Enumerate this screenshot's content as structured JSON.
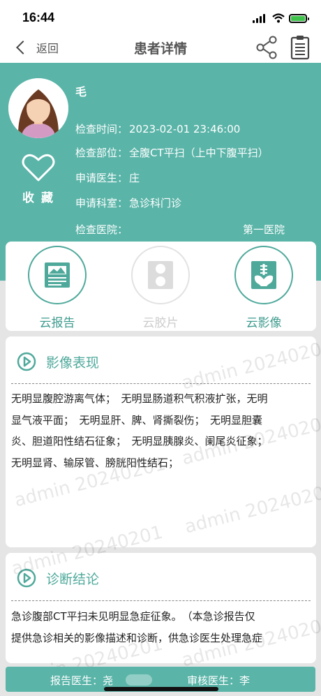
{
  "status_bar": {
    "time": "16:44"
  },
  "nav": {
    "back_label": "返回",
    "title": "患者详情",
    "share_icon": "share-icon",
    "report_icon": "clipboard-icon"
  },
  "patient": {
    "name": "毛",
    "favorite_label": "收 藏",
    "exam_time_label": "检查时间：",
    "exam_time": "2023-02-01 23:46:00",
    "exam_part_label": "检查部位：",
    "exam_part": "全腹CT平扫（上中下腹平扫）",
    "doctor_label": "申请医生：",
    "doctor": "庄",
    "dept_label": "申请科室：",
    "dept": "急诊科门诊",
    "hospital_label": "检查医院：",
    "hospital": "第一医院"
  },
  "tools": [
    {
      "label": "云报告",
      "icon": "report-icon",
      "enabled": true
    },
    {
      "label": "云胶片",
      "icon": "film-icon",
      "enabled": false
    },
    {
      "label": "云影像",
      "icon": "xray-icon",
      "enabled": true
    }
  ],
  "findings": {
    "title": "影像表现",
    "lines": [
      "无明显腹腔游离气体；　无明显肠道积气积液扩张，无明",
      "显气液平面；　无明显肝、脾、肾撕裂伤；　无明显胆囊",
      "炎、胆道阳性结石征象；　无明显胰腺炎、阑尾炎征象；",
      "无明显肾、输尿管、膀胱阳性结石；"
    ]
  },
  "conclusion": {
    "title": "诊断结论",
    "lines": [
      "急诊腹部CT平扫未见明显急症征象。　（本急诊报告仅",
      "提供急诊相关的影像描述和诊断，供急诊医生处理急症"
    ]
  },
  "footer": {
    "report_doctor": "报告医生：尧",
    "review_doctor": "审核医生：李"
  },
  "watermark": "admin 20240201",
  "colors": {
    "accent": "#5ab4a8",
    "accent_text": "#4fa99b",
    "disabled": "#cccccc"
  }
}
